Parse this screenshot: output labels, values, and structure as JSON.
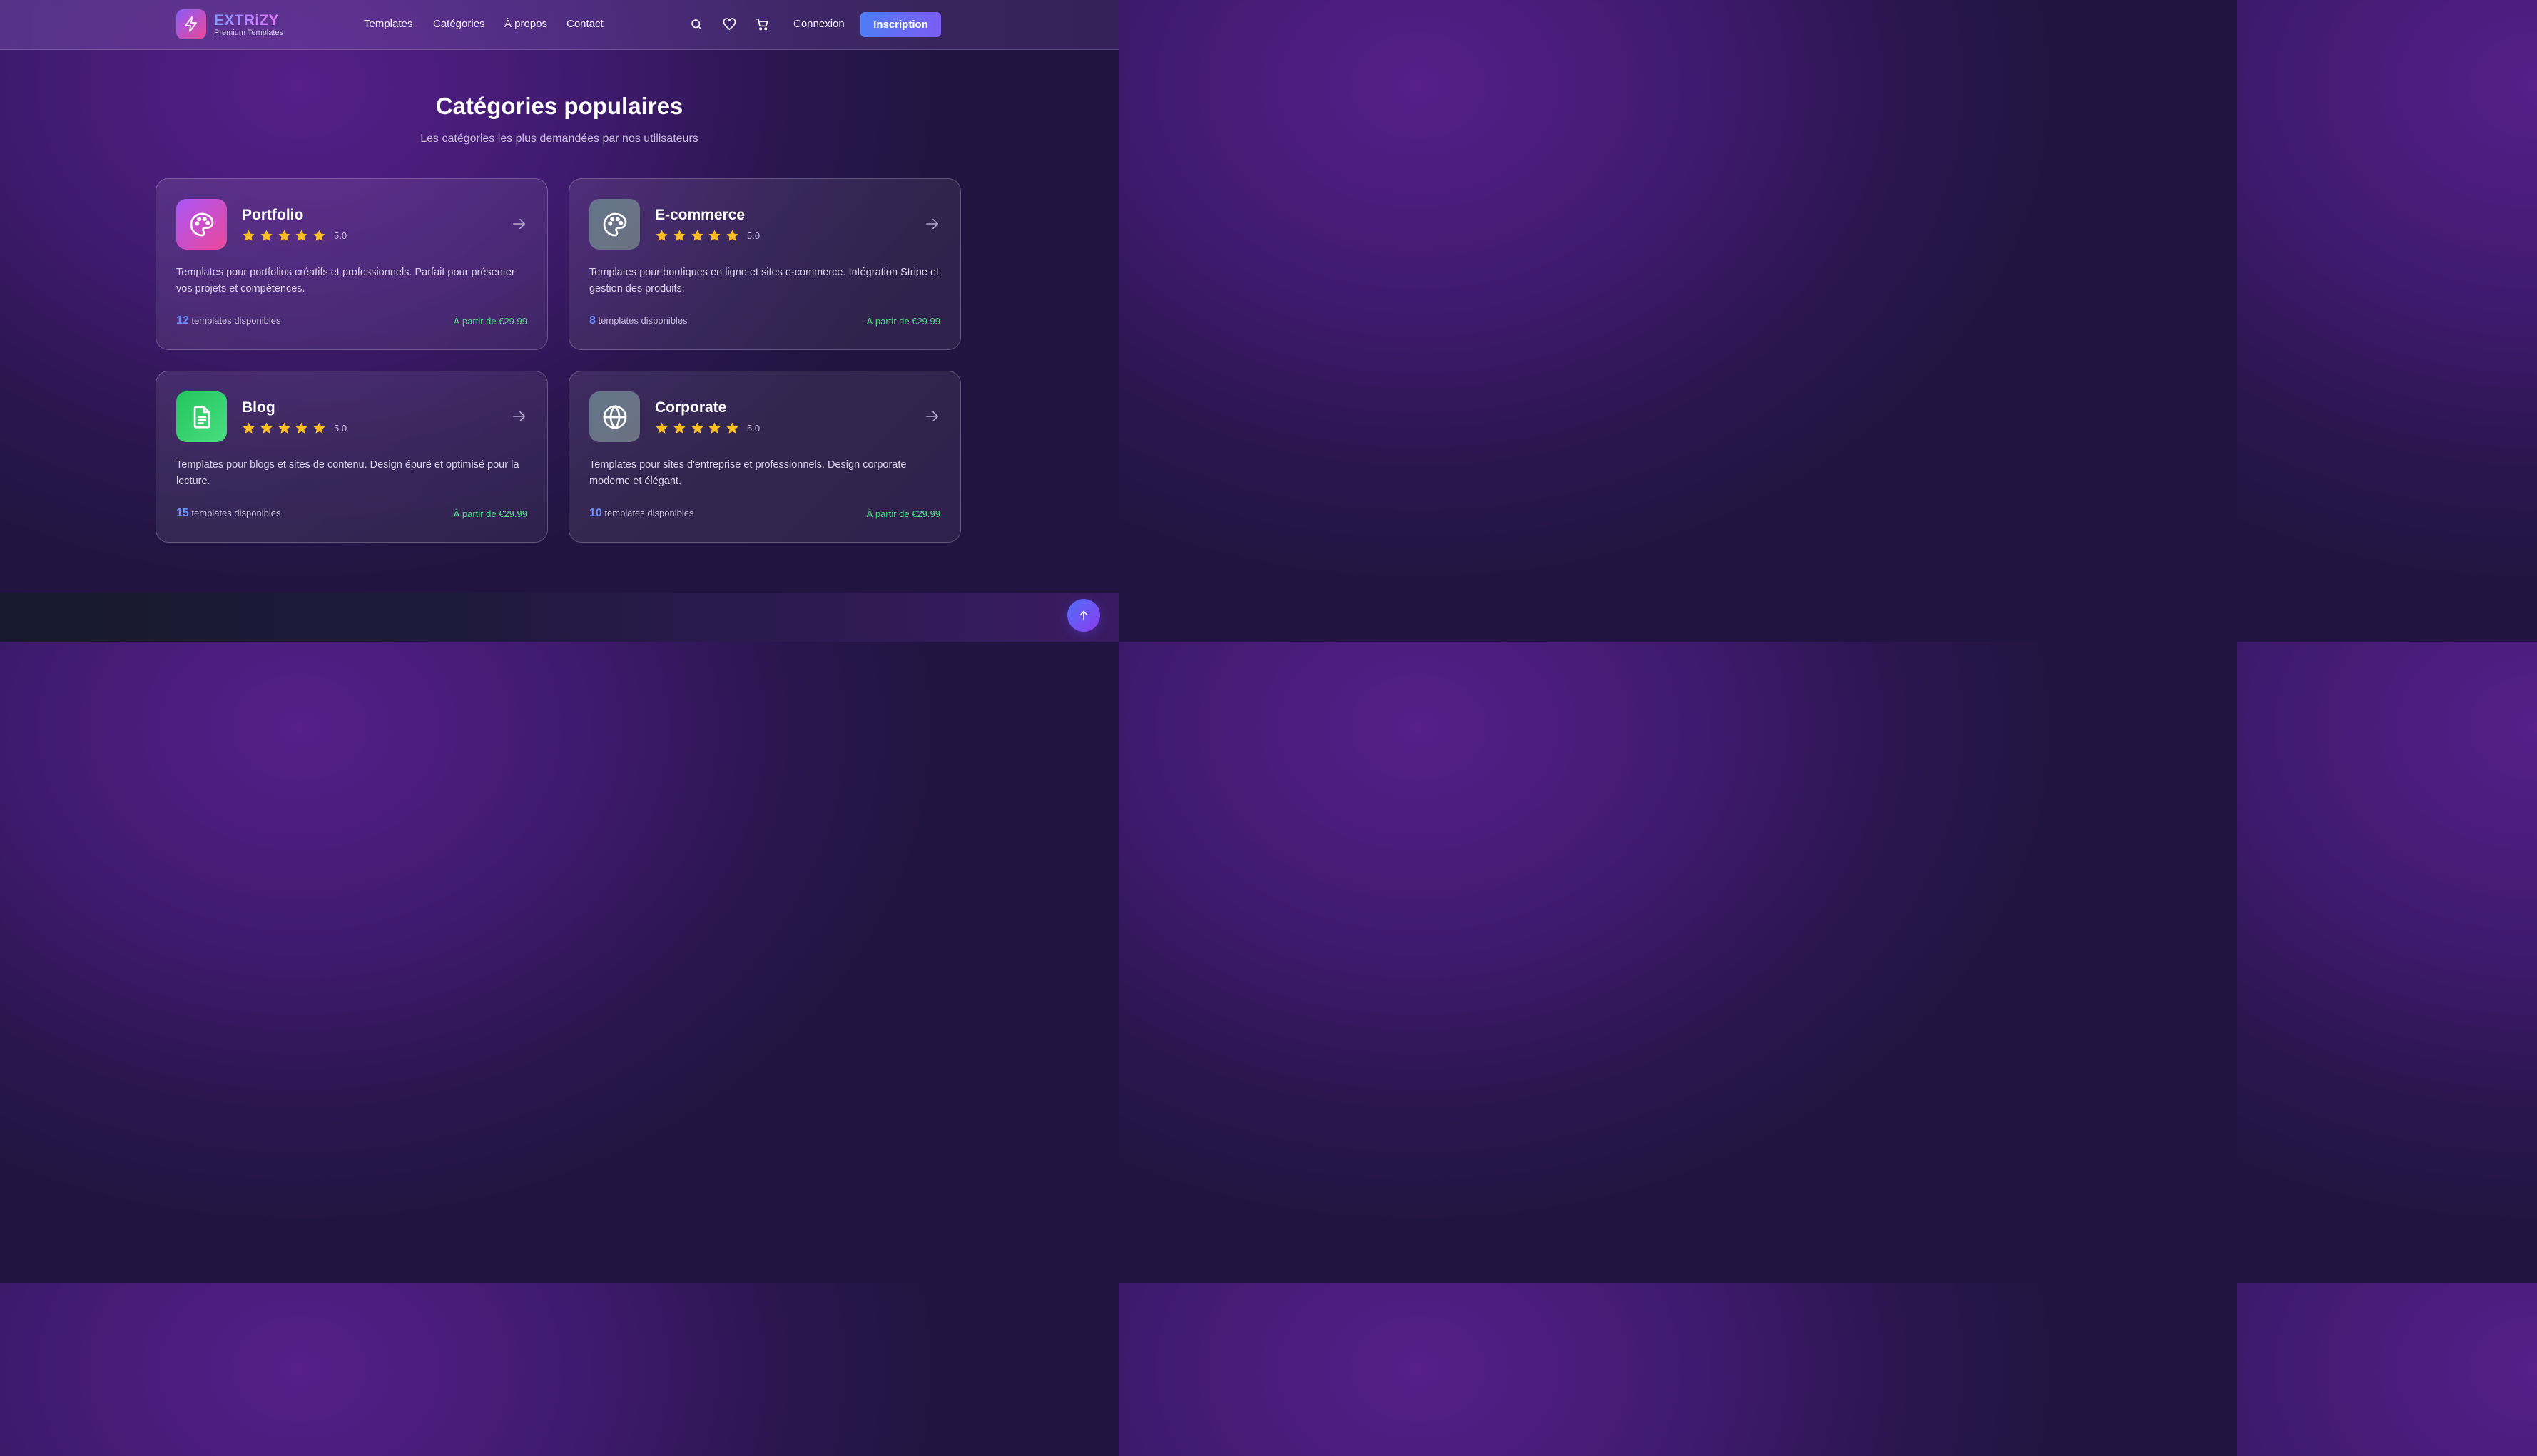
{
  "brand": {
    "name": "EXTRiZY",
    "tagline": "Premium Templates"
  },
  "nav": {
    "items": [
      "Templates",
      "Catégories",
      "À propos",
      "Contact"
    ]
  },
  "header_actions": {
    "icons": [
      "search-icon",
      "heart-icon",
      "cart-icon"
    ],
    "login_label": "Connexion",
    "signup_label": "Inscription"
  },
  "section": {
    "title": "Catégories populaires",
    "subtitle": "Les catégories les plus demandées par nos utilisateurs"
  },
  "cards": [
    {
      "title": "Portfolio",
      "icon": "palette-icon",
      "icon_colors": [
        "#a855f7",
        "#ec4899"
      ],
      "stars": 5,
      "rating": "5.0",
      "description": "Templates pour portfolios créatifs et professionnels. Parfait pour présenter vos projets et compétences.",
      "count": "12",
      "count_label": "templates disponibles",
      "price": "À partir de €29.99"
    },
    {
      "title": "E-commerce",
      "icon": "palette-icon",
      "icon_colors": [
        "#64748b",
        "#6b7280"
      ],
      "stars": 5,
      "rating": "5.0",
      "description": "Templates pour boutiques en ligne et sites e-commerce. Intégration Stripe et gestion des produits.",
      "count": "8",
      "count_label": "templates disponibles",
      "price": "À partir de €29.99"
    },
    {
      "title": "Blog",
      "icon": "document-icon",
      "icon_colors": [
        "#22c55e",
        "#4ade80"
      ],
      "stars": 5,
      "rating": "5.0",
      "description": "Templates pour blogs et sites de contenu. Design épuré et optimisé pour la lecture.",
      "count": "15",
      "count_label": "templates disponibles",
      "price": "À partir de €29.99"
    },
    {
      "title": "Corporate",
      "icon": "globe-icon",
      "icon_colors": [
        "#64748b",
        "#6b7280"
      ],
      "stars": 5,
      "rating": "5.0",
      "description": "Templates pour sites d'entreprise et professionnels. Design corporate moderne et élégant.",
      "count": "10",
      "count_label": "templates disponibles",
      "price": "À partir de €29.99"
    }
  ],
  "colors": {
    "accent": "#4f7cf7",
    "star": "#fbbf24",
    "price": "#4ade80",
    "count": "#6b8cff"
  }
}
